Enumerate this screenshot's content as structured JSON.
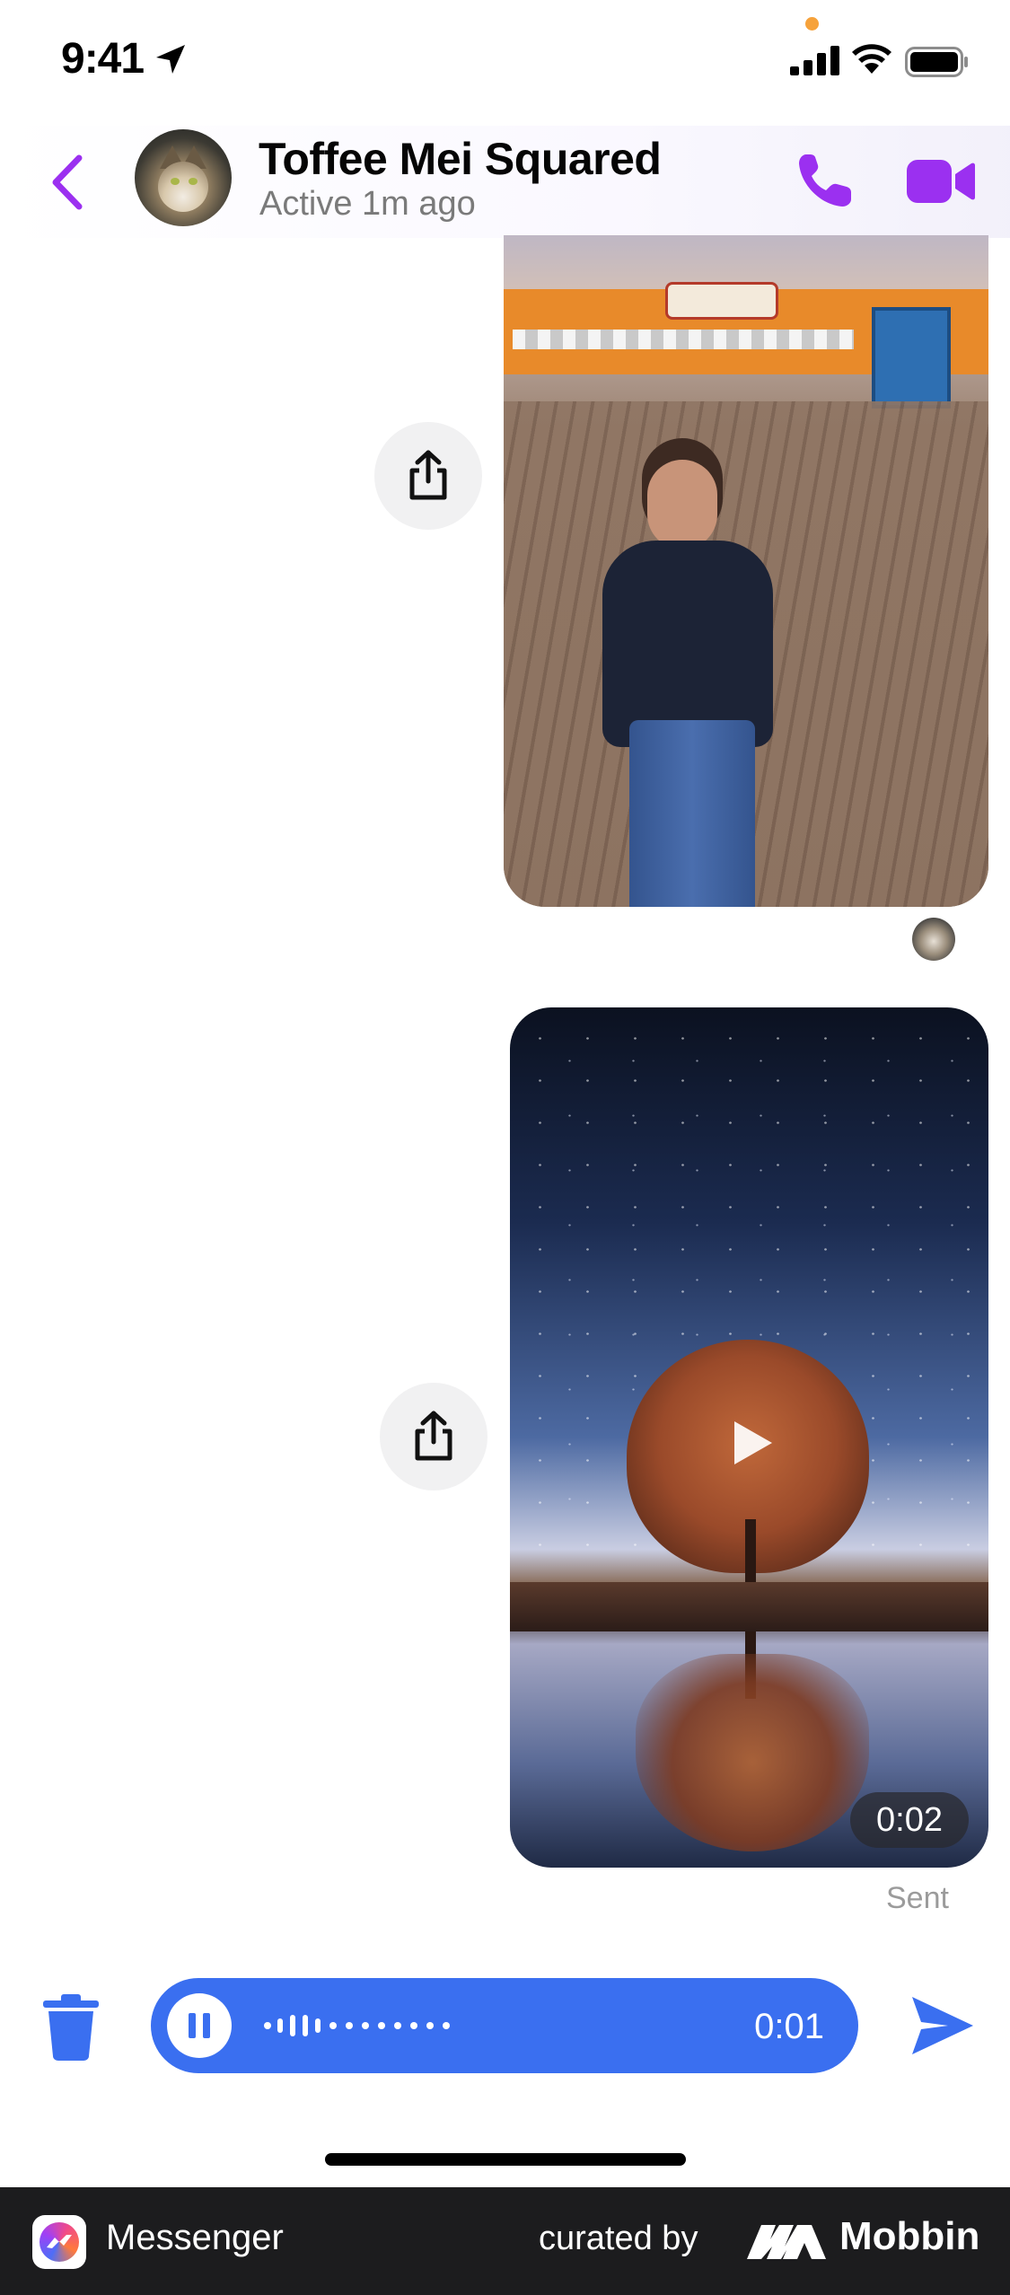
{
  "status_bar": {
    "time": "9:41",
    "icons": [
      "location-arrow-icon",
      "signal-icon",
      "wifi-icon",
      "battery-icon"
    ]
  },
  "header": {
    "contact_name": "Toffee Mei Squared",
    "contact_status": "Active 1m ago",
    "icons": [
      "back-chevron-icon",
      "phone-icon",
      "video-camera-icon"
    ],
    "accent_color": "#9b30f0"
  },
  "messages": [
    {
      "type": "photo",
      "description_icons": [
        "share-icon"
      ]
    },
    {
      "type": "video",
      "duration": "0:02",
      "status": "Sent",
      "description_icons": [
        "share-icon",
        "play-icon"
      ]
    }
  ],
  "composer": {
    "voice_time": "0:01",
    "accent_color": "#3a6ff0",
    "icons": [
      "trash-icon",
      "pause-icon",
      "waveform-icon",
      "send-icon"
    ]
  },
  "footer": {
    "app_name": "Messenger",
    "curated_by": "curated by",
    "brand": "Mobbin"
  }
}
